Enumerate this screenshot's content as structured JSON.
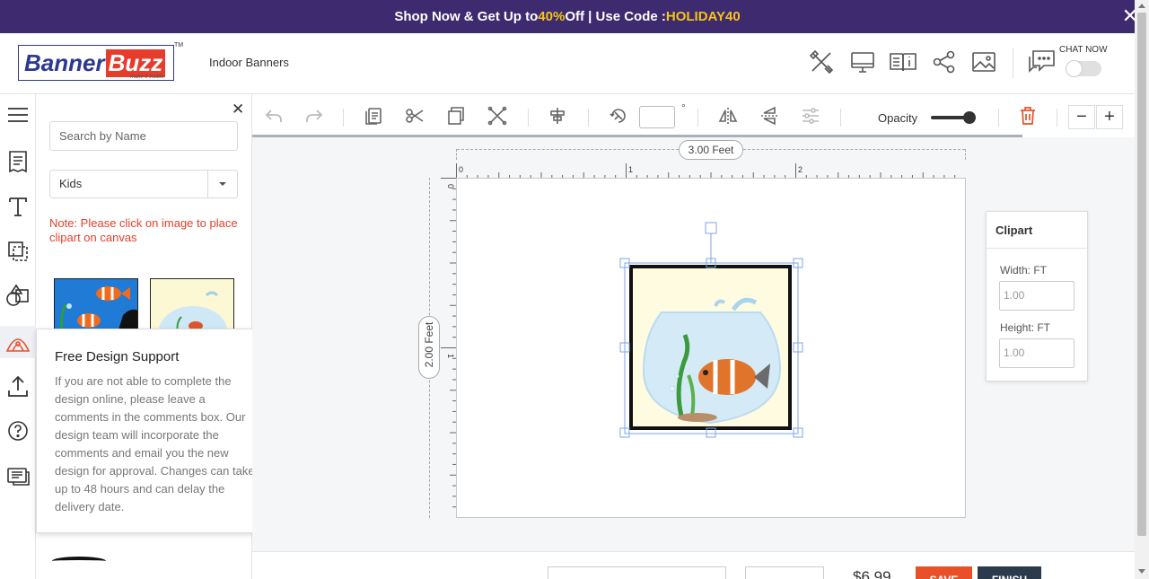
{
  "promo": {
    "prefix": "Shop Now & Get Up to ",
    "percent": "40%",
    "mid": " Off | Use Code : ",
    "code": "HOLIDAY40",
    "close": "✕"
  },
  "header": {
    "logo": {
      "part1": "Banner",
      "part2": "Buzz",
      "tm": "TM",
      "tagline": "make it visible"
    },
    "breadcrumb": "Indoor Banners",
    "icons": [
      "tools-icon",
      "monitor-icon",
      "book-info-icon",
      "share-icon",
      "image-icon",
      "chat-icon"
    ],
    "chat_now": "CHAT NOW"
  },
  "sidebar": {
    "icons": [
      "menu-icon",
      "notes-icon",
      "text-icon",
      "layers-icon",
      "shapes-icon",
      "clipart-icon",
      "upload-icon",
      "help-icon",
      "chat-support-icon"
    ],
    "active": "clipart-icon"
  },
  "panel": {
    "close": "✕",
    "search_placeholder": "Search by Name",
    "category": "Kids",
    "note": "Note: Please click on image to place clipart on canvas"
  },
  "support": {
    "title": "Free Design Support",
    "body": "If you are not able to complete the design online, please leave a comments in the comments box. Our design team will incorporate the comments and email you the new design for approval. Changes can take up to 48 hours and can delay the delivery date.",
    "close": "✕"
  },
  "toolbar": {
    "icons": [
      "undo-icon",
      "redo-icon",
      "paste-icon",
      "cut-icon",
      "copy-icon",
      "close-x-icon",
      "align-center-icon",
      "rotate-icon",
      "flip-horizontal-icon",
      "flip-vertical-icon",
      "adjust-icon",
      "trash-icon"
    ],
    "angle_value": "",
    "degree": "°",
    "opacity_label": "Opacity",
    "opacity": 1.0,
    "zoom_out": "−",
    "zoom_in": "+"
  },
  "canvas": {
    "width_label": "3.00 Feet",
    "height_label": "2.00 Feet",
    "h_ticks": [
      "0",
      "1",
      "2"
    ],
    "v_ticks": [
      "0",
      "1"
    ]
  },
  "props": {
    "title": "Clipart",
    "width_label": "Width: FT",
    "width_value": "1.00",
    "height_label": "Height: FT",
    "height_value": "1.00"
  },
  "footer": {
    "price": "$6.99",
    "save": "SAVE",
    "finish": "FINISH"
  },
  "colors": {
    "promo_bg": "#3e2a6e",
    "highlight": "#f5c518",
    "accent_orange": "#e8502a",
    "note_red": "#e2402b",
    "finish_bg": "#2c3a4d"
  }
}
